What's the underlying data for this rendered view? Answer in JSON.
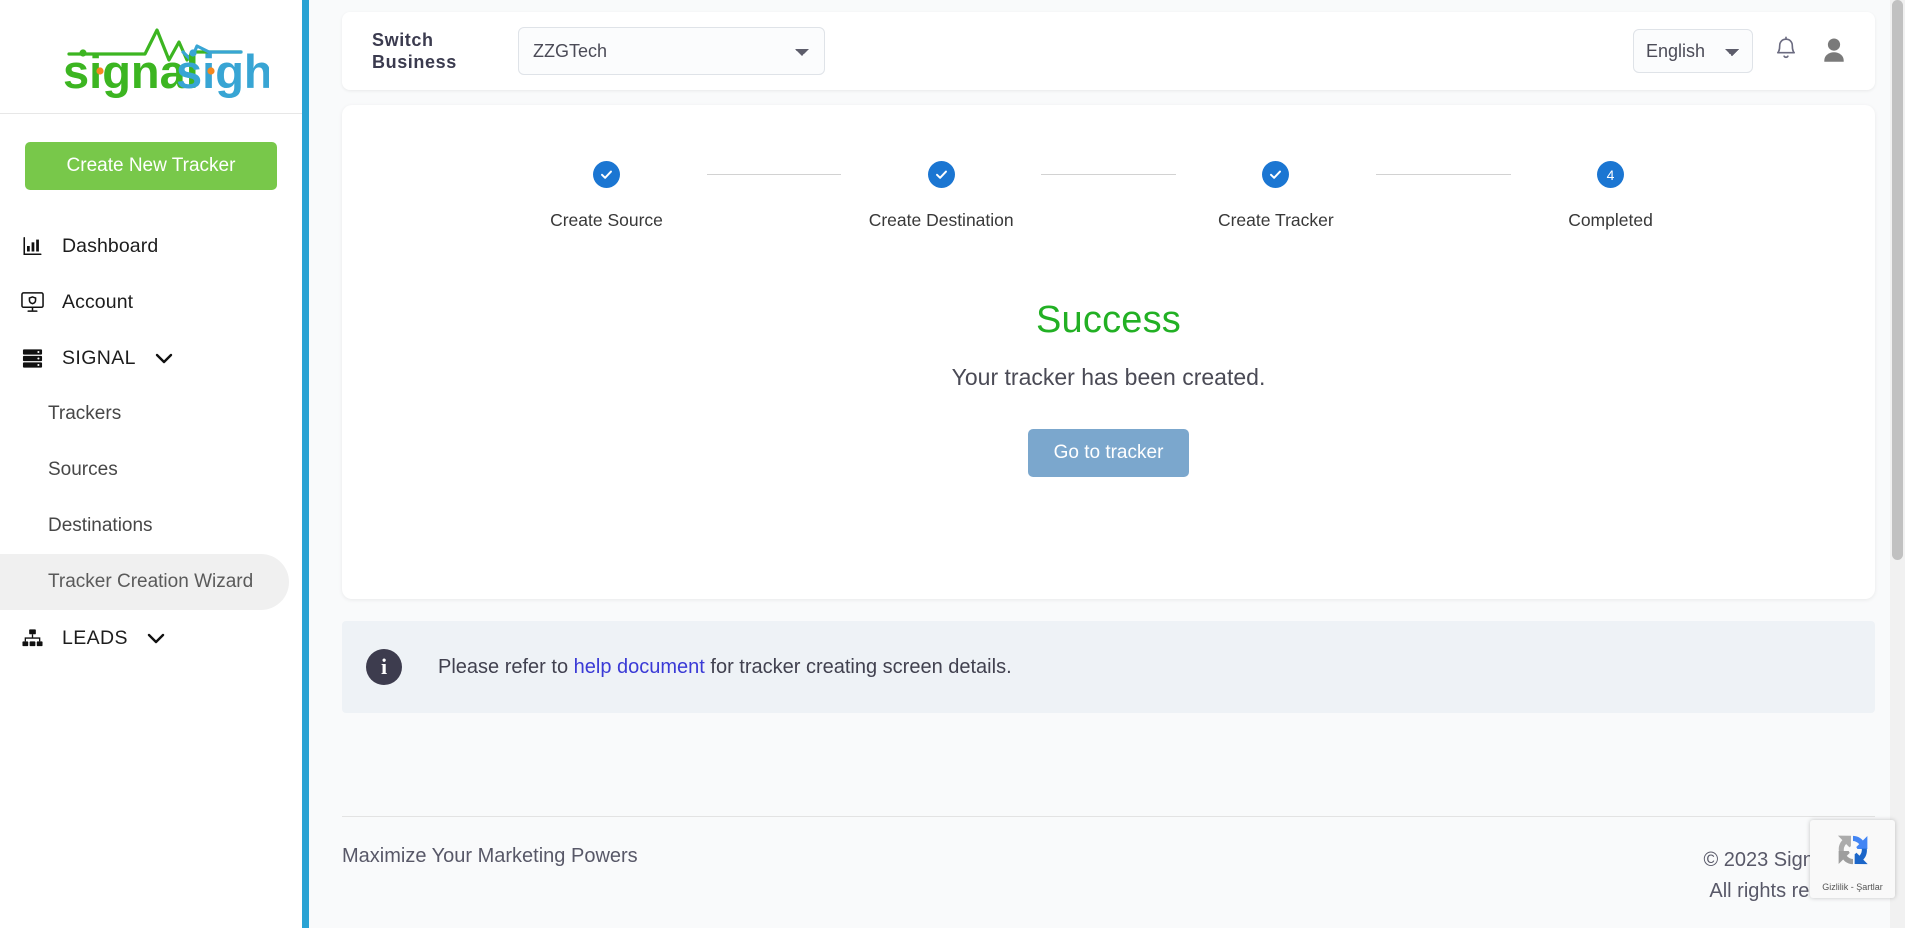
{
  "brand": {
    "name_part1": "signal",
    "name_part2": "sight",
    "color_green": "#3cb521",
    "color_blue": "#38a5d4",
    "color_orange": "#f5881f"
  },
  "sidebar": {
    "create_button": "Create New Tracker",
    "items": [
      {
        "label": "Dashboard",
        "icon": "chart-bar-icon",
        "type": "link"
      },
      {
        "label": "Account",
        "icon": "monitor-shield-icon",
        "type": "link"
      },
      {
        "label": "SIGNAL",
        "icon": "server-stack-icon",
        "type": "group",
        "expanded": true
      },
      {
        "label": "LEADS",
        "icon": "sitemap-icon",
        "type": "group",
        "expanded": false
      }
    ],
    "signal_children": [
      {
        "label": "Trackers",
        "active": false
      },
      {
        "label": "Sources",
        "active": false
      },
      {
        "label": "Destinations",
        "active": false
      },
      {
        "label": "Tracker Creation Wizard",
        "active": true
      }
    ],
    "accent_color": "#29a3d4"
  },
  "header": {
    "switch_business_label": "Switch Business",
    "business_selected": "ZZGTech",
    "business_options": [
      "ZZGTech"
    ],
    "language_selected": "English",
    "language_options": [
      "English"
    ],
    "notification_icon": "bell-icon",
    "avatar_icon": "user-avatar-icon"
  },
  "wizard": {
    "steps": [
      {
        "number": "1",
        "label": "Create Source",
        "state": "complete",
        "mark": "✓"
      },
      {
        "number": "2",
        "label": "Create Destination",
        "state": "complete",
        "mark": "✓"
      },
      {
        "number": "3",
        "label": "Create Tracker",
        "state": "complete",
        "mark": "✓"
      },
      {
        "number": "4",
        "label": "Completed",
        "state": "current",
        "mark": "4"
      }
    ],
    "step_active_color": "#1b76d2",
    "success_title": "Success",
    "success_message": "Your tracker has been created.",
    "go_button": "Go to tracker",
    "success_color": "#22b024",
    "go_button_color": "#7ba7cd"
  },
  "info_banner": {
    "icon": "info-circle-icon",
    "text_before": "Please refer to ",
    "link_text": "help document",
    "text_after": " for tracker creating screen details.",
    "link_color": "#3a3ad6",
    "background": "#eef2f6"
  },
  "footer": {
    "tagline": "Maximize Your Marketing Powers",
    "copyright_line1": "© 2023 SignalSight",
    "copyright_line2": "All rights reserved."
  },
  "recaptcha": {
    "icon": "recaptcha-logo-icon",
    "terms_text": "Gizlilik - Şartlar"
  }
}
